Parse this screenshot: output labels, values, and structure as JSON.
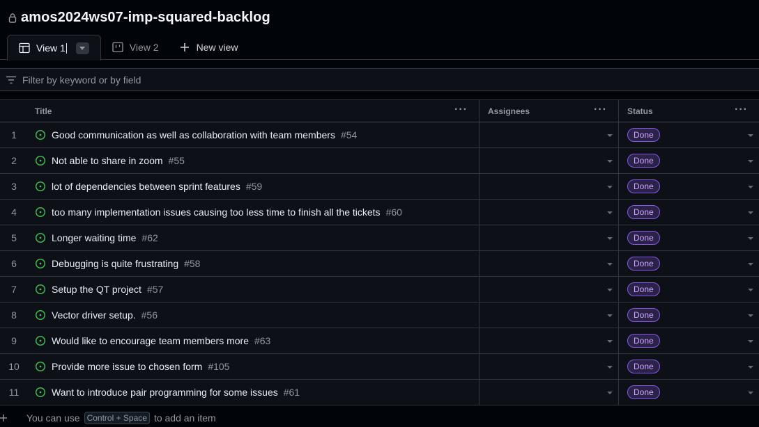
{
  "project": {
    "title": "amos2024ws07-imp-squared-backlog"
  },
  "tabs": [
    {
      "label": "View 1"
    },
    {
      "label": "View 2"
    },
    {
      "label": "New view"
    }
  ],
  "filter": {
    "placeholder": "Filter by keyword or by field"
  },
  "table": {
    "columns": {
      "title": "Title",
      "assignees": "Assignees",
      "status": "Status"
    },
    "rows": [
      {
        "num": "1",
        "title": "Good communication as well as collaboration with team members",
        "issue": "#54",
        "status": "Done"
      },
      {
        "num": "2",
        "title": "Not able to share in zoom",
        "issue": "#55",
        "status": "Done"
      },
      {
        "num": "3",
        "title": "lot of dependencies between sprint features",
        "issue": "#59",
        "status": "Done"
      },
      {
        "num": "4",
        "title": "too many implementation issues causing too less time to finish all the tickets",
        "issue": "#60",
        "status": "Done"
      },
      {
        "num": "5",
        "title": "Longer waiting time",
        "issue": "#62",
        "status": "Done"
      },
      {
        "num": "6",
        "title": "Debugging is quite frustrating",
        "issue": "#58",
        "status": "Done"
      },
      {
        "num": "7",
        "title": "Setup the QT project",
        "issue": "#57",
        "status": "Done"
      },
      {
        "num": "8",
        "title": "Vector driver setup.",
        "issue": "#56",
        "status": "Done"
      },
      {
        "num": "9",
        "title": "Would like to encourage team members more",
        "issue": "#63",
        "status": "Done"
      },
      {
        "num": "10",
        "title": "Provide more issue to chosen form",
        "issue": "#105",
        "status": "Done"
      },
      {
        "num": "11",
        "title": "Want to introduce pair programming for some issues",
        "issue": "#61",
        "status": "Done"
      }
    ]
  },
  "footer": {
    "prefix": "You can use",
    "shortcut": "Control + Space",
    "suffix": "to add an item"
  },
  "colors": {
    "open_issue": "#3fb950",
    "done_badge": "#d2a8ff"
  }
}
